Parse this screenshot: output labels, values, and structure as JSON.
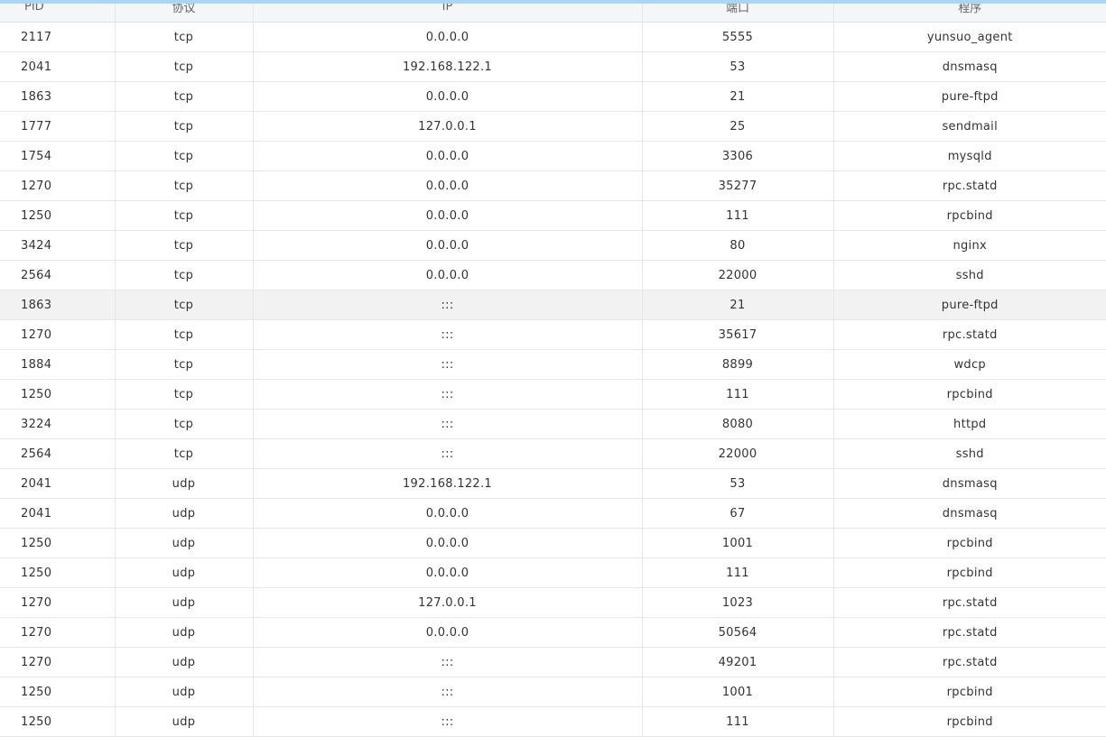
{
  "table": {
    "columns": [
      "PID",
      "协议",
      "IP",
      "端口",
      "程序"
    ],
    "rows": [
      {
        "pid": "2117",
        "protocol": "tcp",
        "ip": "0.0.0.0",
        "port": "5555",
        "program": "yunsuo_agent"
      },
      {
        "pid": "2041",
        "protocol": "tcp",
        "ip": "192.168.122.1",
        "port": "53",
        "program": "dnsmasq"
      },
      {
        "pid": "1863",
        "protocol": "tcp",
        "ip": "0.0.0.0",
        "port": "21",
        "program": "pure-ftpd"
      },
      {
        "pid": "1777",
        "protocol": "tcp",
        "ip": "127.0.0.1",
        "port": "25",
        "program": "sendmail"
      },
      {
        "pid": "1754",
        "protocol": "tcp",
        "ip": "0.0.0.0",
        "port": "3306",
        "program": "mysqld"
      },
      {
        "pid": "1270",
        "protocol": "tcp",
        "ip": "0.0.0.0",
        "port": "35277",
        "program": "rpc.statd"
      },
      {
        "pid": "1250",
        "protocol": "tcp",
        "ip": "0.0.0.0",
        "port": "111",
        "program": "rpcbind"
      },
      {
        "pid": "3424",
        "protocol": "tcp",
        "ip": "0.0.0.0",
        "port": "80",
        "program": "nginx"
      },
      {
        "pid": "2564",
        "protocol": "tcp",
        "ip": "0.0.0.0",
        "port": "22000",
        "program": "sshd"
      },
      {
        "pid": "1863",
        "protocol": "tcp",
        "ip": ":::",
        "port": "21",
        "program": "pure-ftpd",
        "highlighted": true
      },
      {
        "pid": "1270",
        "protocol": "tcp",
        "ip": ":::",
        "port": "35617",
        "program": "rpc.statd"
      },
      {
        "pid": "1884",
        "protocol": "tcp",
        "ip": ":::",
        "port": "8899",
        "program": "wdcp"
      },
      {
        "pid": "1250",
        "protocol": "tcp",
        "ip": ":::",
        "port": "111",
        "program": "rpcbind"
      },
      {
        "pid": "3224",
        "protocol": "tcp",
        "ip": ":::",
        "port": "8080",
        "program": "httpd"
      },
      {
        "pid": "2564",
        "protocol": "tcp",
        "ip": ":::",
        "port": "22000",
        "program": "sshd"
      },
      {
        "pid": "2041",
        "protocol": "udp",
        "ip": "192.168.122.1",
        "port": "53",
        "program": "dnsmasq"
      },
      {
        "pid": "2041",
        "protocol": "udp",
        "ip": "0.0.0.0",
        "port": "67",
        "program": "dnsmasq"
      },
      {
        "pid": "1250",
        "protocol": "udp",
        "ip": "0.0.0.0",
        "port": "1001",
        "program": "rpcbind"
      },
      {
        "pid": "1250",
        "protocol": "udp",
        "ip": "0.0.0.0",
        "port": "111",
        "program": "rpcbind"
      },
      {
        "pid": "1270",
        "protocol": "udp",
        "ip": "127.0.0.1",
        "port": "1023",
        "program": "rpc.statd"
      },
      {
        "pid": "1270",
        "protocol": "udp",
        "ip": "0.0.0.0",
        "port": "50564",
        "program": "rpc.statd"
      },
      {
        "pid": "1270",
        "protocol": "udp",
        "ip": ":::",
        "port": "49201",
        "program": "rpc.statd"
      },
      {
        "pid": "1250",
        "protocol": "udp",
        "ip": ":::",
        "port": "1001",
        "program": "rpcbind"
      },
      {
        "pid": "1250",
        "protocol": "udp",
        "ip": ":::",
        "port": "111",
        "program": "rpcbind"
      }
    ]
  },
  "colors": {
    "accent": "#a9d6f5",
    "header_bg": "#f5f6f7",
    "row_highlight": "#f2f2f2",
    "border": "#e6e6e6"
  }
}
